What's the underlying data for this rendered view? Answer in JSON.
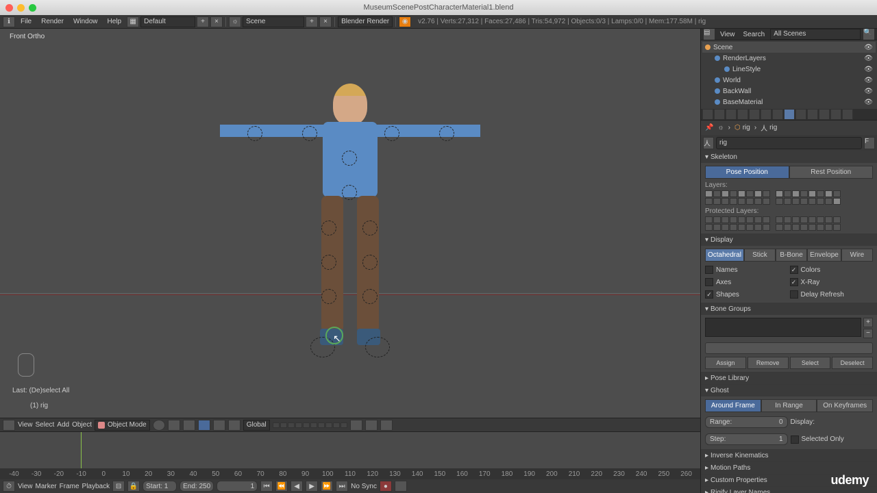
{
  "title": "MuseumScenePostCharacterMaterial1.blend",
  "menubar": {
    "file": "File",
    "render": "Render",
    "window": "Window",
    "help": "Help",
    "layout": "Default",
    "scene": "Scene",
    "engine": "Blender Render",
    "stats": "v2.76 | Verts:27,312 | Faces:27,486 | Tris:54,972 | Objects:0/3 | Lamps:0/0 | Mem:177.58M | rig"
  },
  "viewport": {
    "label": "Front Ortho",
    "last": "Last: (De)select All",
    "rig": "(1)  rig"
  },
  "viewport_footer": {
    "view": "View",
    "select": "Select",
    "add": "Add",
    "object": "Object",
    "mode": "Object Mode",
    "orient": "Global"
  },
  "timeline": {
    "view": "View",
    "marker": "Marker",
    "frame": "Frame",
    "playback": "Playback",
    "start_label": "Start:",
    "start": "1",
    "end_label": "End:",
    "end": "250",
    "current": "1",
    "sync": "No Sync",
    "ticks": [
      "-40",
      "-30",
      "-20",
      "-10",
      "0",
      "10",
      "20",
      "30",
      "40",
      "50",
      "60",
      "70",
      "80",
      "90",
      "100",
      "110",
      "120",
      "130",
      "140",
      "150",
      "160",
      "170",
      "180",
      "190",
      "200",
      "210",
      "220",
      "230",
      "240",
      "250",
      "260"
    ]
  },
  "outliner": {
    "view": "View",
    "search": "Search",
    "filter": "All Scenes",
    "items": [
      {
        "name": "Scene",
        "indent": 0,
        "sel": true
      },
      {
        "name": "RenderLayers",
        "indent": 1
      },
      {
        "name": "LineStyle",
        "indent": 2
      },
      {
        "name": "World",
        "indent": 1
      },
      {
        "name": "BackWall",
        "indent": 1
      },
      {
        "name": "BaseMaterial",
        "indent": 1
      }
    ]
  },
  "breadcrumb": {
    "obj": "rig",
    "data": "rig"
  },
  "search_field": "rig",
  "panels": {
    "skeleton": {
      "title": "Skeleton",
      "pose": "Pose Position",
      "rest": "Rest Position",
      "layers": "Layers:",
      "protected": "Protected Layers:"
    },
    "display": {
      "title": "Display",
      "modes": [
        "Octahedral",
        "Stick",
        "B-Bone",
        "Envelope",
        "Wire"
      ],
      "names": "Names",
      "colors": "Colors",
      "axes": "Axes",
      "xray": "X-Ray",
      "shapes": "Shapes",
      "delay": "Delay Refresh"
    },
    "bonegroups": {
      "title": "Bone Groups",
      "assign": "Assign",
      "remove": "Remove",
      "select": "Select",
      "deselect": "Deselect"
    },
    "poselib": {
      "title": "Pose Library"
    },
    "ghost": {
      "title": "Ghost",
      "around": "Around Frame",
      "inrange": "In Range",
      "onkeys": "On Keyframes",
      "range_label": "Range:",
      "range": "0",
      "display_label": "Display:",
      "step_label": "Step:",
      "step": "1",
      "selected": "Selected Only"
    },
    "ik": {
      "title": "Inverse Kinematics"
    },
    "motion": {
      "title": "Motion Paths"
    },
    "custom": {
      "title": "Custom Properties"
    },
    "rigify": {
      "title": "Rigify Layer Names"
    }
  },
  "udemy": "udemy"
}
